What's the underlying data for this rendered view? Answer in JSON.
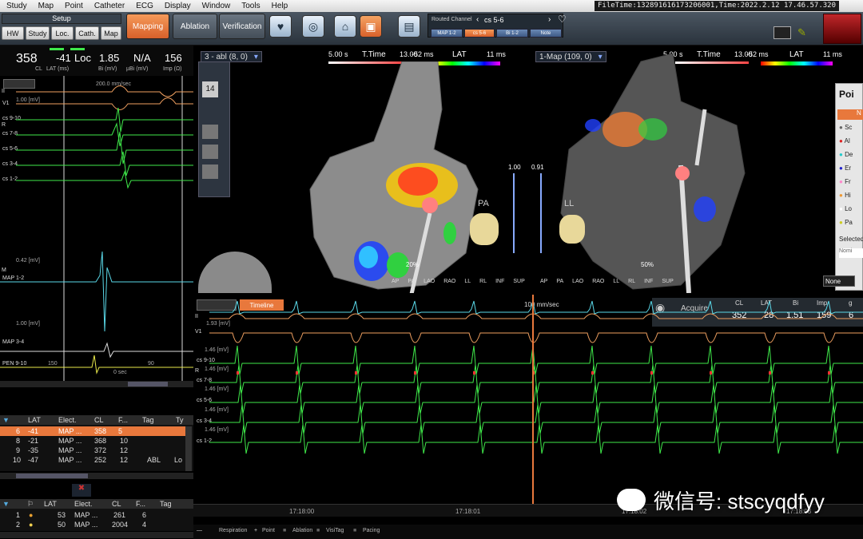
{
  "menu": [
    "Study",
    "Map",
    "Point",
    "Catheter",
    "ECG",
    "Display",
    "Window",
    "Tools",
    "Help"
  ],
  "filetime": "FileTime:132891616173206001,Time:2022.2.12 17.46.57.320",
  "setup": {
    "label": "Setup",
    "buttons": [
      "HW",
      "Study",
      "Loc.",
      "Cath.",
      "Map"
    ]
  },
  "workflow": {
    "mapping": "Mapping",
    "ablation": "Ablation",
    "verification": "Verification"
  },
  "routed": {
    "label": "Routed Channel",
    "channel": "cs 5-6",
    "chips": [
      "MAP 1-2",
      "cs 5-6",
      "Bi 1-2",
      "Note"
    ]
  },
  "stats": {
    "cl_value": "358",
    "cl_label": "CL",
    "lat_value": "-41",
    "lat_label": "LAT (ms)",
    "loc_label": "Loc",
    "bi_value": "1.85",
    "bi_label": "Bi (mV)",
    "ubi_value": "N/A",
    "ubi_label": "µBi (mV)",
    "imp_value": "156",
    "imp_label": "Imp (Ω)"
  },
  "left_ecg": {
    "speed": "200.0 mm/sec",
    "mv": "1.00 [mV]",
    "mv2": "0.42 [mV]",
    "channels": [
      "II",
      "V1",
      "cs 9-10",
      "cs 7-8",
      "cs 5-6",
      "cs 3-4",
      "cs 1-2",
      "MAP 1-2",
      "MAP 3-4",
      "PEN 9-10"
    ],
    "r_label": "R",
    "m_label": "M",
    "t150": "150",
    "t0": "0 sec",
    "t90": "90"
  },
  "point_table": {
    "headers": [
      "LAT",
      "Elect.",
      "CL",
      "F...",
      "Tag",
      "Ty"
    ],
    "rows": [
      {
        "n": "6",
        "lat": "-41",
        "el": "MAP ...",
        "cl": "358",
        "f": "5",
        "tag": "",
        "ty": ""
      },
      {
        "n": "8",
        "lat": "-21",
        "el": "MAP ...",
        "cl": "368",
        "f": "10",
        "tag": "",
        "ty": ""
      },
      {
        "n": "9",
        "lat": "-35",
        "el": "MAP ...",
        "cl": "372",
        "f": "12",
        "tag": "",
        "ty": ""
      },
      {
        "n": "10",
        "lat": "-47",
        "el": "MAP ...",
        "cl": "252",
        "f": "12",
        "tag": "ABL",
        "ty": "Lo"
      }
    ]
  },
  "tag_table": {
    "headers": [
      "LAT",
      "Elect.",
      "CL",
      "F...",
      "Tag"
    ],
    "rows": [
      {
        "n": "1",
        "lat": "53",
        "el": "MAP ...",
        "cl": "261",
        "f": "6"
      },
      {
        "n": "2",
        "lat": "50",
        "el": "MAP ...",
        "cl": "2004",
        "f": "4"
      }
    ]
  },
  "map_left": {
    "title": "3 - abl (8, 0)",
    "time_scale": "5.00 s",
    "ttime": "T.Time",
    "ttime_val": "13.00",
    "ms1": "-52 ms",
    "lat": "LAT",
    "ms2": "11 ms",
    "zoom": "1.00",
    "pct": "20%",
    "orient": "PA",
    "num14": "14",
    "views": [
      "AP",
      "PA",
      "LAO",
      "RAO",
      "LL",
      "RL",
      "INF",
      "SUP"
    ]
  },
  "map_right": {
    "title": "1-Map (109, 0)",
    "time_scale": "5.00 s",
    "ttime": "T.Time",
    "ttime_val": "13.00",
    "ms1": "-52 ms",
    "lat": "LAT",
    "ms2": "11 ms",
    "zoom": "0.91",
    "pct": "50%",
    "orient": "LL",
    "views": [
      "AP",
      "PA",
      "LAO",
      "RAO",
      "LL",
      "RL",
      "INF",
      "SUP"
    ]
  },
  "poi": {
    "title": "Poi",
    "items": [
      "N",
      "Sc",
      "Al",
      "De",
      "Er",
      "Fr",
      "Hi",
      "Lo",
      "Pa"
    ],
    "selected": "Selected",
    "none": "None",
    "nomi": "Nomi"
  },
  "ecg": {
    "timeline": "Timeline",
    "speed": "100 mm/sec",
    "acquire": "Acquire",
    "hud_labels": [
      "CL",
      "LAT",
      "Bi",
      "Imp",
      "g"
    ],
    "hud_values": [
      "352",
      "28",
      "1.51",
      "159",
      "6"
    ],
    "channels": [
      "II",
      "V1",
      "cs 9-10",
      "cs 7-8",
      "cs 5-6",
      "cs 3-4",
      "cs 1-2"
    ],
    "mv_top": "1.93 [mV]",
    "mv": "1.46 [mV]",
    "r": "R",
    "times": [
      "17:18:00",
      "17:18:01",
      "17:18:02",
      "17:18:03"
    ]
  },
  "legend": [
    "Respiration",
    "Point",
    "Ablation",
    "VisiTag",
    "Pacing"
  ],
  "watermark": "微信号: stscyqdfyy",
  "colors": {
    "accent": "#e8783c",
    "ecg_green": "#3fe84a",
    "ecg_orange": "#f0a060",
    "ecg_cyan": "#5ad8e8"
  }
}
